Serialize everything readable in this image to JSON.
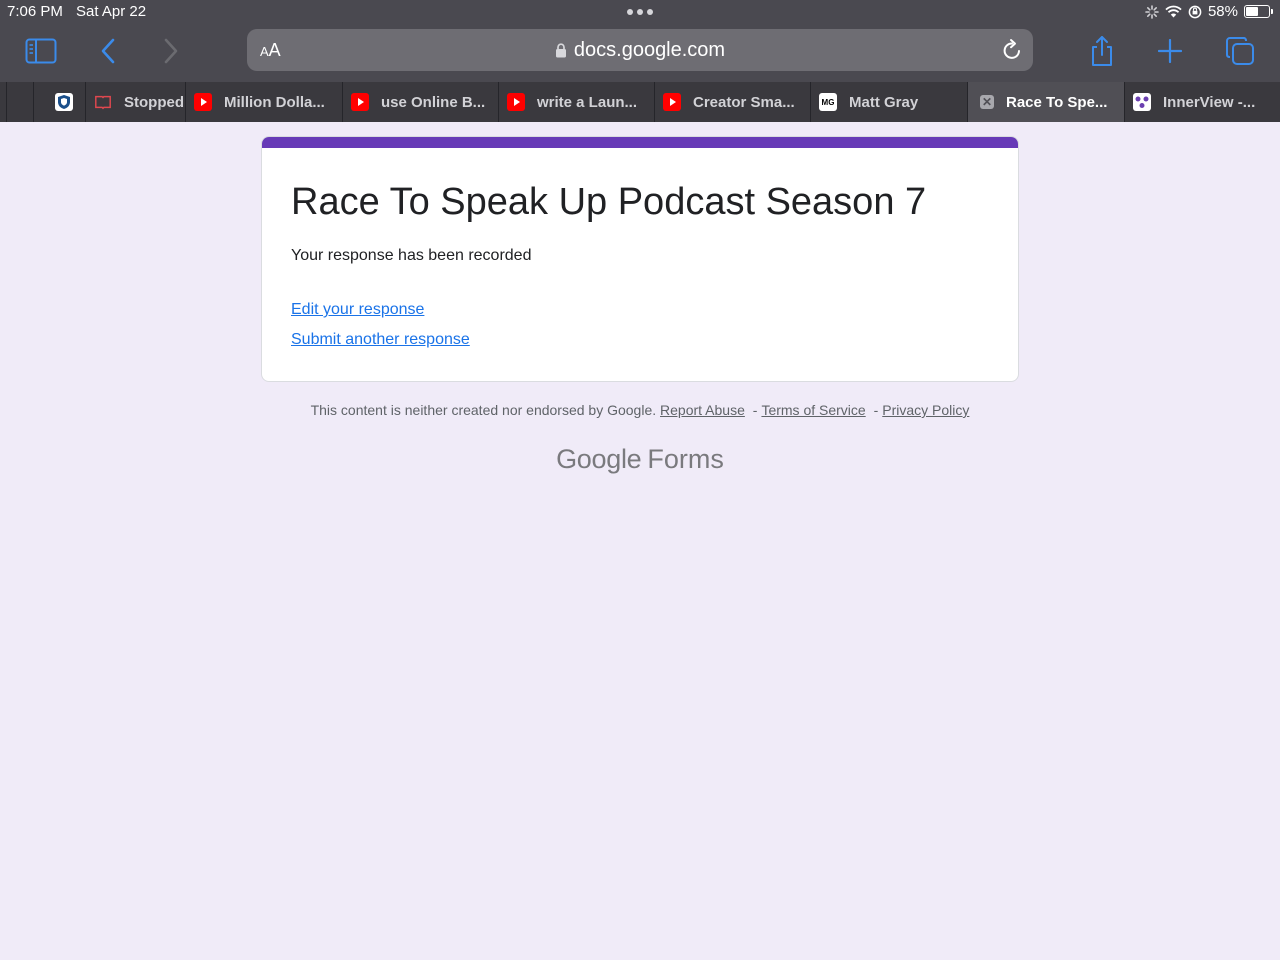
{
  "status": {
    "time": "7:06 PM",
    "date": "Sat Apr 22",
    "battery_percent": "58%",
    "battery_level": 0.58
  },
  "toolbar": {
    "aa_label_small": "A",
    "aa_label_large": "A",
    "url": "docs.google.com"
  },
  "tabs": [
    {
      "label": "",
      "icon": "shield-icon"
    },
    {
      "label": "Stopped",
      "icon": "book-icon"
    },
    {
      "label": "Million Dolla...",
      "icon": "youtube-icon"
    },
    {
      "label": "use Online B...",
      "icon": "youtube-icon"
    },
    {
      "label": "write a Laun...",
      "icon": "youtube-icon"
    },
    {
      "label": "Creator Sma...",
      "icon": "youtube-icon"
    },
    {
      "label": "Matt Gray",
      "icon": "mg-icon",
      "icon_text": "MG"
    },
    {
      "label": "Race To Spe...",
      "icon": "close-icon",
      "icon_text": "✕"
    },
    {
      "label": "InnerView -...",
      "icon": "innerview-icon"
    }
  ],
  "form": {
    "accent_color": "#673ab7",
    "title": "Race To Speak Up Podcast Season 7",
    "message": "Your response has been recorded",
    "edit_link": "Edit your response",
    "submit_another_link": "Submit another response"
  },
  "footer": {
    "disclaimer": "This content is neither created nor endorsed by Google.",
    "report_abuse": "Report Abuse",
    "terms": "Terms of Service",
    "privacy": "Privacy Policy",
    "separator": "-",
    "brand_google": "Google",
    "brand_forms": "Forms"
  }
}
